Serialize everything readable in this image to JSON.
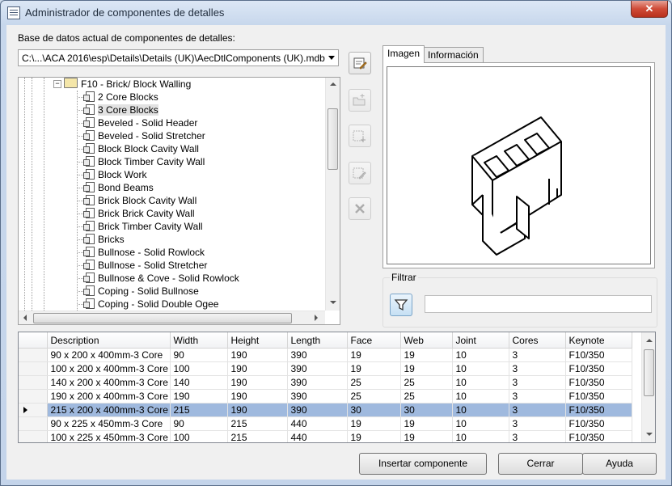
{
  "window": {
    "title": "Administrador de componentes de detalles",
    "close_glyph": "✕"
  },
  "database": {
    "label": "Base de datos actual de componentes de detalles:",
    "value": "C:\\...\\ACA 2016\\esp\\Details\\Details (UK)\\AecDtlComponents (UK).mdb"
  },
  "tree": {
    "folder": "F10 - Brick/ Block Walling",
    "items": [
      "2 Core Blocks",
      "3 Core Blocks",
      "Beveled - Solid Header",
      "Beveled - Solid Stretcher",
      "Block Block Cavity Wall",
      "Block Timber Cavity Wall",
      "Block Work",
      "Bond Beams",
      "Brick Block Cavity Wall",
      "Brick Brick Cavity Wall",
      "Brick Timber Cavity Wall",
      "Bricks",
      "Bullnose - Solid Rowlock",
      "Bullnose - Solid Stretcher",
      "Bullnose & Cove - Solid Rowlock",
      "Coping - Solid Bullnose",
      "Coping - Solid Double Ogee"
    ],
    "selected_item": "3 Core Blocks"
  },
  "toolbar": {
    "icons": [
      "edit-database-icon",
      "new-folder-icon",
      "new-component-icon",
      "edit-component-icon",
      "delete-icon"
    ]
  },
  "tabs": [
    {
      "label": "Imagen",
      "active": true
    },
    {
      "label": "Información",
      "active": false
    }
  ],
  "filter": {
    "label": "Filtrar",
    "value": "",
    "icon": "funnel-icon"
  },
  "table": {
    "columns": [
      "Description",
      "Width",
      "Height",
      "Length",
      "Face",
      "Web",
      "Joint",
      "Cores",
      "Keynote"
    ],
    "rows": [
      [
        "90 x 200 x 400mm-3 Core",
        "90",
        "190",
        "390",
        "19",
        "19",
        "10",
        "3",
        "F10/350"
      ],
      [
        "100 x 200 x 400mm-3 Core",
        "100",
        "190",
        "390",
        "19",
        "19",
        "10",
        "3",
        "F10/350"
      ],
      [
        "140 x 200 x 400mm-3 Core",
        "140",
        "190",
        "390",
        "25",
        "25",
        "10",
        "3",
        "F10/350"
      ],
      [
        "190 x 200 x 400mm-3 Core",
        "190",
        "190",
        "390",
        "25",
        "25",
        "10",
        "3",
        "F10/350"
      ],
      [
        "215 x 200 x 400mm-3 Core",
        "215",
        "190",
        "390",
        "30",
        "30",
        "10",
        "3",
        "F10/350"
      ],
      [
        "90 x 225 x 450mm-3 Core",
        "90",
        "215",
        "440",
        "19",
        "19",
        "10",
        "3",
        "F10/350"
      ],
      [
        "100 x 225 x 450mm-3 Core",
        "100",
        "215",
        "440",
        "19",
        "19",
        "10",
        "3",
        "F10/350"
      ]
    ],
    "selected_row": 4
  },
  "buttons": {
    "insert": "Insertar componente",
    "close": "Cerrar",
    "help": "Ayuda"
  },
  "colors": {
    "selection": "#9fb9de",
    "close_button": "#cf4b37"
  }
}
